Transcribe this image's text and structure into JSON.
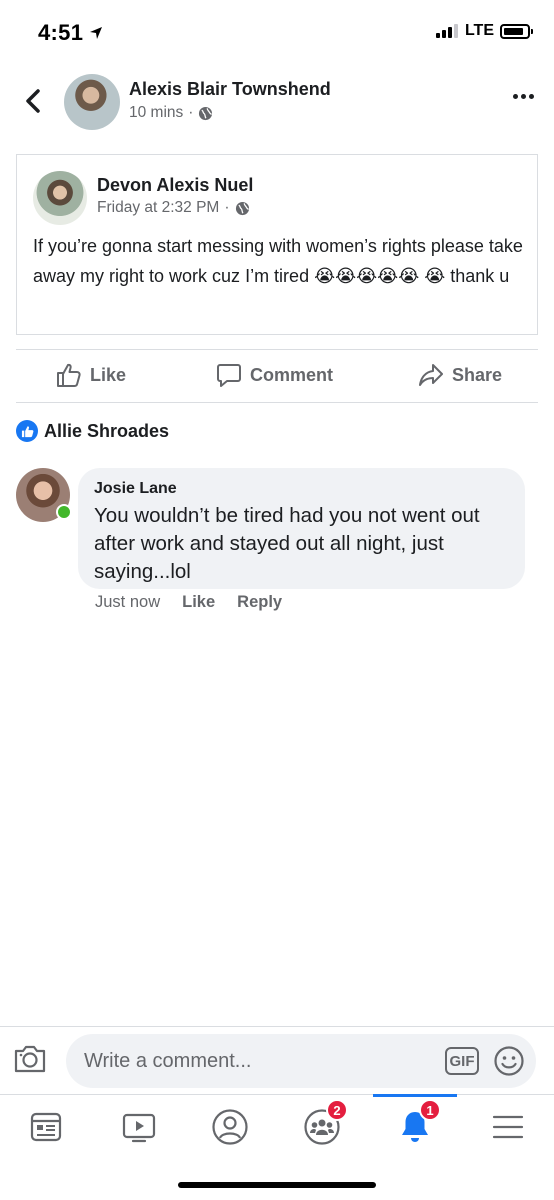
{
  "status_bar": {
    "time": "4:51",
    "network": "LTE",
    "signal_bars": 3,
    "battery_fraction": 0.8
  },
  "post": {
    "author": "Alexis Blair Townshend",
    "time": "10 mins",
    "separator": "·",
    "privacy_icon": "globe-icon"
  },
  "shared_post": {
    "author": "Devon Alexis Nuel",
    "time": "Friday at 2:32 PM",
    "separator": "·",
    "privacy_icon": "globe-icon",
    "text": "If you’re gonna start messing with women’s rights please take away my right to work cuz I’m tired 😭😭😭😭😭 😭 thank u"
  },
  "actions": {
    "like": "Like",
    "comment": "Comment",
    "share": "Share"
  },
  "reaction": {
    "name": "Allie Shroades",
    "icon": "thumbs-up-icon"
  },
  "comment": {
    "author": "Josie Lane",
    "text": "You wouldn’t be tired had you not went out after work and stayed out all night, just saying...lol",
    "time": "Just now",
    "like": "Like",
    "reply": "Reply",
    "online": true
  },
  "composer": {
    "placeholder": "Write a comment...",
    "gif": "GIF"
  },
  "tabbar": {
    "tabs": [
      {
        "name": "news-feed",
        "icon": "feed-icon",
        "badge": ""
      },
      {
        "name": "watch",
        "icon": "video-icon",
        "badge": ""
      },
      {
        "name": "profile",
        "icon": "profile-icon",
        "badge": ""
      },
      {
        "name": "groups",
        "icon": "groups-icon",
        "badge": "2"
      },
      {
        "name": "notifications",
        "icon": "bell-icon",
        "badge": "1",
        "active": true
      },
      {
        "name": "menu",
        "icon": "menu-icon",
        "badge": ""
      }
    ]
  },
  "colors": {
    "accent": "#1877f2",
    "badge": "#e41e3f",
    "online": "#42b72a",
    "secondary_text": "#65676b",
    "bubble": "#f0f2f5"
  }
}
